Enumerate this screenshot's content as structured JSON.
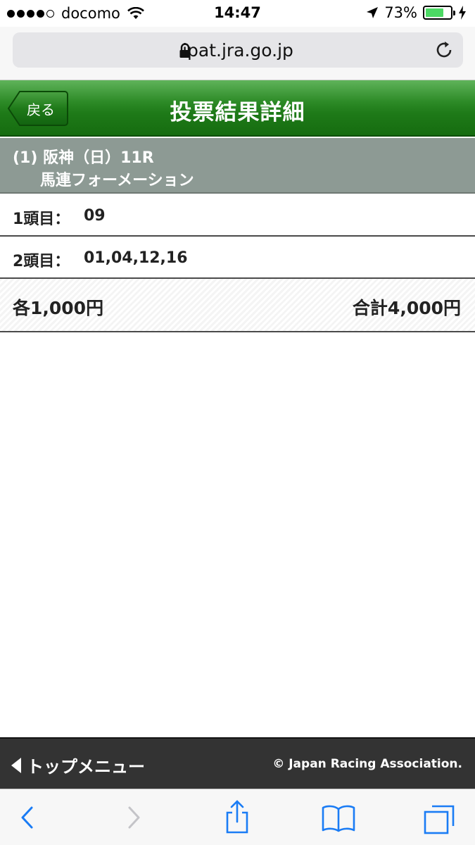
{
  "status_bar": {
    "carrier": "docomo",
    "time": "14:47",
    "battery_percent": "73%",
    "battery_level": 0.73,
    "signal_bars": 4
  },
  "browser": {
    "url": "ipat.jra.go.jp"
  },
  "header": {
    "back_label": "戻る",
    "title": "投票結果詳細"
  },
  "race": {
    "line1": "(1) 阪神（日）11R",
    "line2": "馬連フォーメーション"
  },
  "selections": [
    {
      "label": "1頭目：",
      "value": "09"
    },
    {
      "label": "2頭目：",
      "value": "01,04,12,16"
    }
  ],
  "amount": {
    "each": "各1,000円",
    "total": "合計4,000円"
  },
  "footer": {
    "top_menu": "トップメニュー",
    "copyright": "© Japan Racing Association."
  },
  "colors": {
    "header_green": "#1e7a18",
    "race_bar": "#8d9a94",
    "footer": "#333333",
    "ios_blue": "#1a7cf5"
  }
}
